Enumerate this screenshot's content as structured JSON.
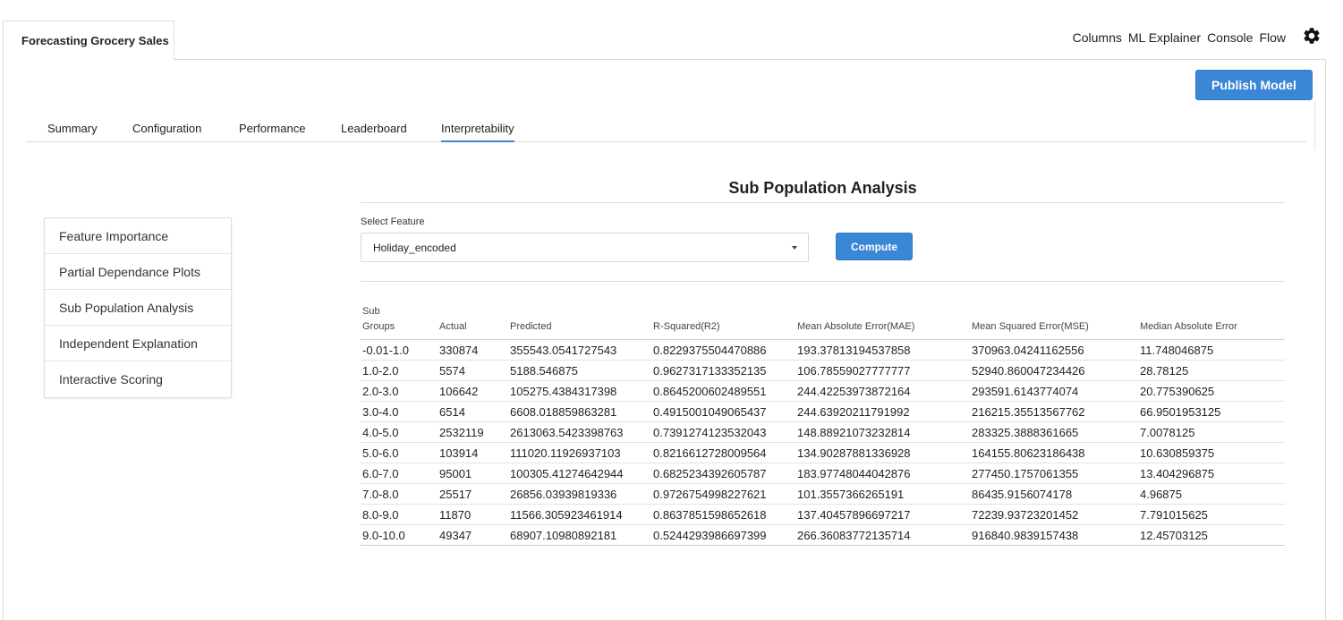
{
  "app": {
    "tab_title": "Forecasting Grocery Sales"
  },
  "top_links": [
    "Columns",
    "ML Explainer",
    "Console",
    "Flow"
  ],
  "icons": {
    "settings": "gear-icon",
    "dropdown": "caret-down-icon"
  },
  "colors": {
    "accent": "#3a87d5"
  },
  "actions": {
    "publish_label": "Publish Model",
    "compute_label": "Compute"
  },
  "nav_tabs": [
    {
      "label": "Summary",
      "active": false
    },
    {
      "label": "Configuration",
      "active": false
    },
    {
      "label": "Performance",
      "active": false
    },
    {
      "label": "Leaderboard",
      "active": false
    },
    {
      "label": "Interpretability",
      "active": true
    }
  ],
  "side_menu": [
    "Feature Importance",
    "Partial Dependance Plots",
    "Sub Population Analysis",
    "Independent Explanation",
    "Interactive Scoring"
  ],
  "section": {
    "title": "Sub Population Analysis"
  },
  "feature_select": {
    "label": "Select Feature",
    "value": "Holiday_encoded"
  },
  "table": {
    "columns": [
      "Sub Groups",
      "Actual",
      "Predicted",
      "R-Squared(R2)",
      "Mean Absolute Error(MAE)",
      "Mean Squared Error(MSE)",
      "Median Absolute Error"
    ],
    "rows": [
      [
        "-0.01-1.0",
        "330874",
        "355543.0541727543",
        "0.8229375504470886",
        "193.37813194537858",
        "370963.04241162556",
        "11.748046875"
      ],
      [
        "1.0-2.0",
        "5574",
        "5188.546875",
        "0.9627317133352135",
        "106.78559027777777",
        "52940.860047234426",
        "28.78125"
      ],
      [
        "2.0-3.0",
        "106642",
        "105275.4384317398",
        "0.8645200602489551",
        "244.42253973872164",
        "293591.6143774074",
        "20.775390625"
      ],
      [
        "3.0-4.0",
        "6514",
        "6608.018859863281",
        "0.4915001049065437",
        "244.63920211791992",
        "216215.35513567762",
        "66.9501953125"
      ],
      [
        "4.0-5.0",
        "2532119",
        "2613063.5423398763",
        "0.7391274123532043",
        "148.88921073232814",
        "283325.3888361665",
        "7.0078125"
      ],
      [
        "5.0-6.0",
        "103914",
        "111020.11926937103",
        "0.8216612728009564",
        "134.90287881336928",
        "164155.80623186438",
        "10.630859375"
      ],
      [
        "6.0-7.0",
        "95001",
        "100305.41274642944",
        "0.6825234392605787",
        "183.97748044042876",
        "277450.1757061355",
        "13.404296875"
      ],
      [
        "7.0-8.0",
        "25517",
        "26856.03939819336",
        "0.9726754998227621",
        "101.3557366265191",
        "86435.9156074178",
        "4.96875"
      ],
      [
        "8.0-9.0",
        "11870",
        "11566.305923461914",
        "0.8637851598652618",
        "137.40457896697217",
        "72239.93723201452",
        "7.791015625"
      ],
      [
        "9.0-10.0",
        "49347",
        "68907.10980892181",
        "0.5244293986697399",
        "266.36083772135714",
        "916840.9839157438",
        "12.45703125"
      ]
    ]
  }
}
